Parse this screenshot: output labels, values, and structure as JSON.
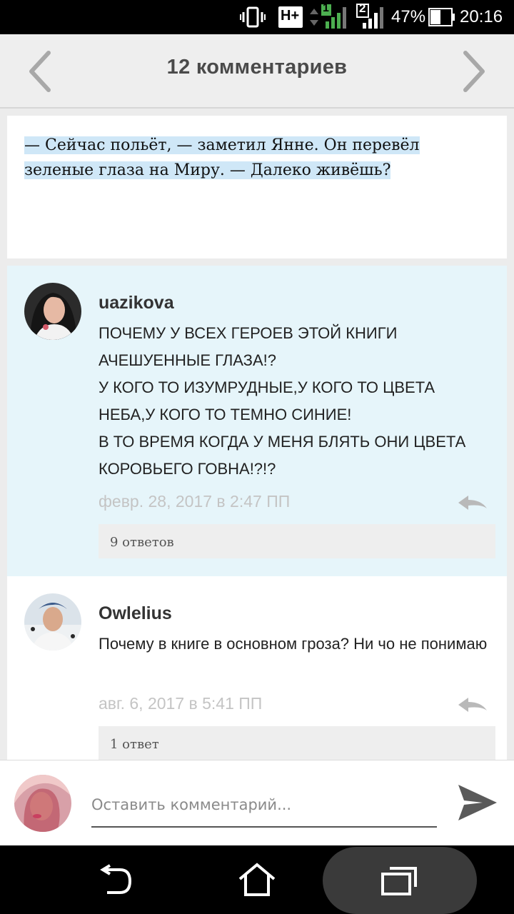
{
  "status_bar": {
    "network_type": "H+",
    "sim1_label": "1",
    "sim2_label": "2",
    "battery_percent": "47%",
    "time": "20:16",
    "icons": [
      "vibrate-icon",
      "network-h-plus-icon",
      "signal-sim1-icon",
      "signal-sim2-icon",
      "battery-icon"
    ]
  },
  "header": {
    "title": "12 комментариев",
    "prev_icon": "chevron-left-icon",
    "next_icon": "chevron-right-icon"
  },
  "quote": {
    "text": "— Сейчас польёт, — заметил Янне. Он перевёл зеленые глаза на Миру. — Далеко живёшь?",
    "highlight_color": "#cfe7f7"
  },
  "comments": [
    {
      "username": "uazikova",
      "text": "ПОЧЕМУ У ВСЕХ ГЕРОЕВ ЭТОЙ КНИГИ АЧЕШУЕННЫЕ ГЛАЗА!?\nУ КОГО ТО ИЗУМРУДНЫЕ,У КОГО ТО ЦВЕТА НЕБА,У КОГО ТО ТЕМНО СИНИЕ!\nВ ТО ВРЕМЯ КОГДА У МЕНЯ БЛЯТЬ ОНИ ЦВЕТА КОРОВЬЕГО ГОВНА!?!?",
      "time": "февр. 28, 2017 в 2:47 ПП",
      "replies": "9 ответов",
      "background": "#e6f5fa"
    },
    {
      "username": "Owlelius",
      "text": "Почему в книге в основном гроза? Ни чо не понимаю",
      "time": "авг. 6, 2017 в 5:41 ПП",
      "replies": "1 ответ",
      "background": "#ffffff"
    }
  ],
  "composer": {
    "placeholder": "Оставить комментарий...",
    "value": "",
    "send_icon": "send-icon"
  },
  "navigation": {
    "buttons": [
      "back-icon",
      "home-icon",
      "recent-apps-icon"
    ]
  },
  "colors": {
    "header_bg": "#eeeeee",
    "accent_text": "#4a4a4a",
    "timestamp": "#c4c4c4"
  }
}
